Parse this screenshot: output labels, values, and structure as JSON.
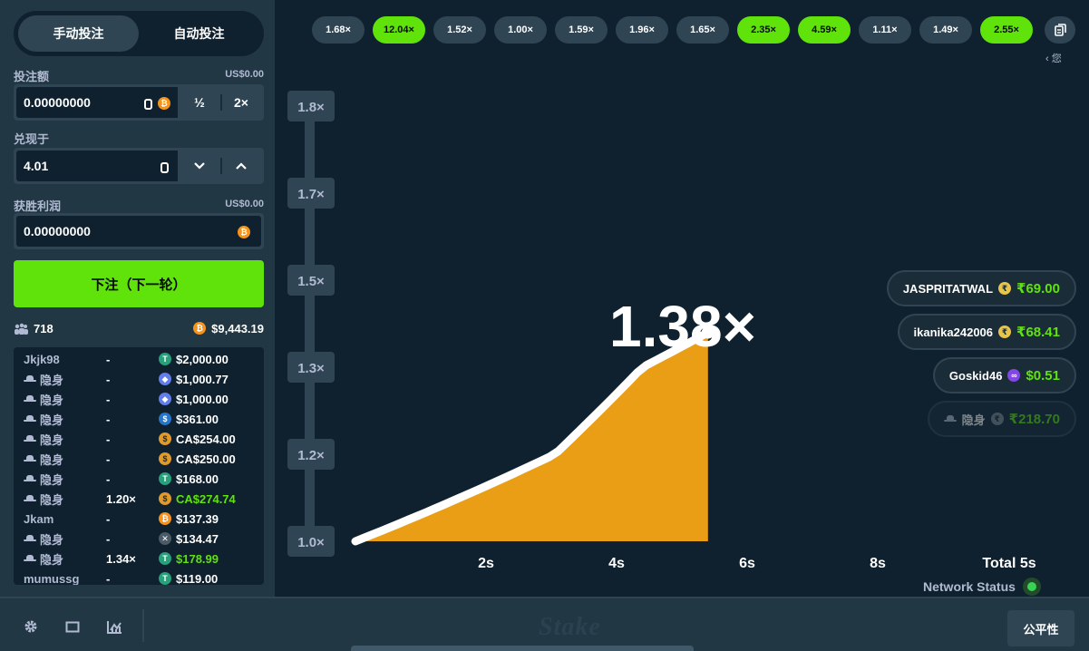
{
  "sidebar": {
    "tabs": [
      {
        "label": "手动投注",
        "active": true
      },
      {
        "label": "自动投注",
        "active": false
      }
    ],
    "bet_amount": {
      "label": "投注额",
      "usd": "US$0.00",
      "value": "0.00000000",
      "half": "½",
      "double": "2×"
    },
    "cashout": {
      "label": "兑现于",
      "value": "4.01"
    },
    "profit": {
      "label": "获胜利润",
      "usd": "US$0.00",
      "value": "0.00000000"
    },
    "bet_button": "下注（下一轮）",
    "stats": {
      "players": "718",
      "total": "$9,443.19"
    },
    "bets": [
      {
        "user": "Jkjk98",
        "hidden": false,
        "mult": "-",
        "coin": "usdt",
        "amount": "$2,000.00",
        "win": false
      },
      {
        "user": "隐身",
        "hidden": true,
        "mult": "-",
        "coin": "eth",
        "amount": "$1,000.77",
        "win": false
      },
      {
        "user": "隐身",
        "hidden": true,
        "mult": "-",
        "coin": "eth",
        "amount": "$1,000.00",
        "win": false
      },
      {
        "user": "隐身",
        "hidden": true,
        "mult": "-",
        "coin": "usdc",
        "amount": "$361.00",
        "win": false
      },
      {
        "user": "隐身",
        "hidden": true,
        "mult": "-",
        "coin": "cad",
        "amount": "CA$254.00",
        "win": false
      },
      {
        "user": "隐身",
        "hidden": true,
        "mult": "-",
        "coin": "cad",
        "amount": "CA$250.00",
        "win": false
      },
      {
        "user": "隐身",
        "hidden": true,
        "mult": "-",
        "coin": "usdt",
        "amount": "$168.00",
        "win": false
      },
      {
        "user": "隐身",
        "hidden": true,
        "mult": "1.20×",
        "coin": "cad",
        "amount": "CA$274.74",
        "win": true
      },
      {
        "user": "Jkam",
        "hidden": false,
        "mult": "-",
        "coin": "btc",
        "amount": "$137.39",
        "win": false
      },
      {
        "user": "隐身",
        "hidden": true,
        "mult": "-",
        "coin": "xrp",
        "amount": "$134.47",
        "win": false
      },
      {
        "user": "隐身",
        "hidden": true,
        "mult": "1.34×",
        "coin": "usdt",
        "amount": "$178.99",
        "win": true
      },
      {
        "user": "mumussg",
        "hidden": false,
        "mult": "-",
        "coin": "usdt",
        "amount": "$119.00",
        "win": false
      }
    ]
  },
  "history": [
    {
      "value": "1.68×",
      "green": false
    },
    {
      "value": "12.04×",
      "green": true
    },
    {
      "value": "1.52×",
      "green": false
    },
    {
      "value": "1.00×",
      "green": false
    },
    {
      "value": "1.59×",
      "green": false
    },
    {
      "value": "1.96×",
      "green": false
    },
    {
      "value": "1.65×",
      "green": false
    },
    {
      "value": "2.35×",
      "green": true
    },
    {
      "value": "4.59×",
      "green": true
    },
    {
      "value": "1.11×",
      "green": false
    },
    {
      "value": "1.49×",
      "green": false
    },
    {
      "value": "2.55×",
      "green": true
    }
  ],
  "you_label": "‹ 您",
  "chart_data": {
    "type": "area",
    "current_multiplier": "1.38×",
    "current_value": 1.38,
    "elapsed_s": 5.4,
    "y_ticks": [
      {
        "label": "1.0×",
        "value": 1.0
      },
      {
        "label": "1.2×",
        "value": 1.2
      },
      {
        "label": "1.3×",
        "value": 1.3
      },
      {
        "label": "1.5×",
        "value": 1.5
      },
      {
        "label": "1.7×",
        "value": 1.7
      },
      {
        "label": "1.8×",
        "value": 1.8
      }
    ],
    "x_ticks": [
      {
        "label": "2s",
        "value": 2
      },
      {
        "label": "4s",
        "value": 4
      },
      {
        "label": "6s",
        "value": 6
      },
      {
        "label": "8s",
        "value": 8
      }
    ],
    "total_label": "Total 5s",
    "curve_color": "#ffffff",
    "fill_color": "#e99e15"
  },
  "players": [
    {
      "name": "JASPRITATWAL",
      "coin": "inr",
      "amount": "₹69.00",
      "faded": false
    },
    {
      "name": "ikanika242006",
      "coin": "inr",
      "amount": "₹68.41",
      "faded": false
    },
    {
      "name": "Goskid46",
      "coin": "pol",
      "amount": "$0.51",
      "faded": false
    },
    {
      "name": "隐身",
      "coin": "inr",
      "amount": "₹218.70",
      "faded": true,
      "hidden": true
    }
  ],
  "network_label": "Network Status",
  "bottom": {
    "logo": "Stake",
    "fairness": "公平性"
  }
}
